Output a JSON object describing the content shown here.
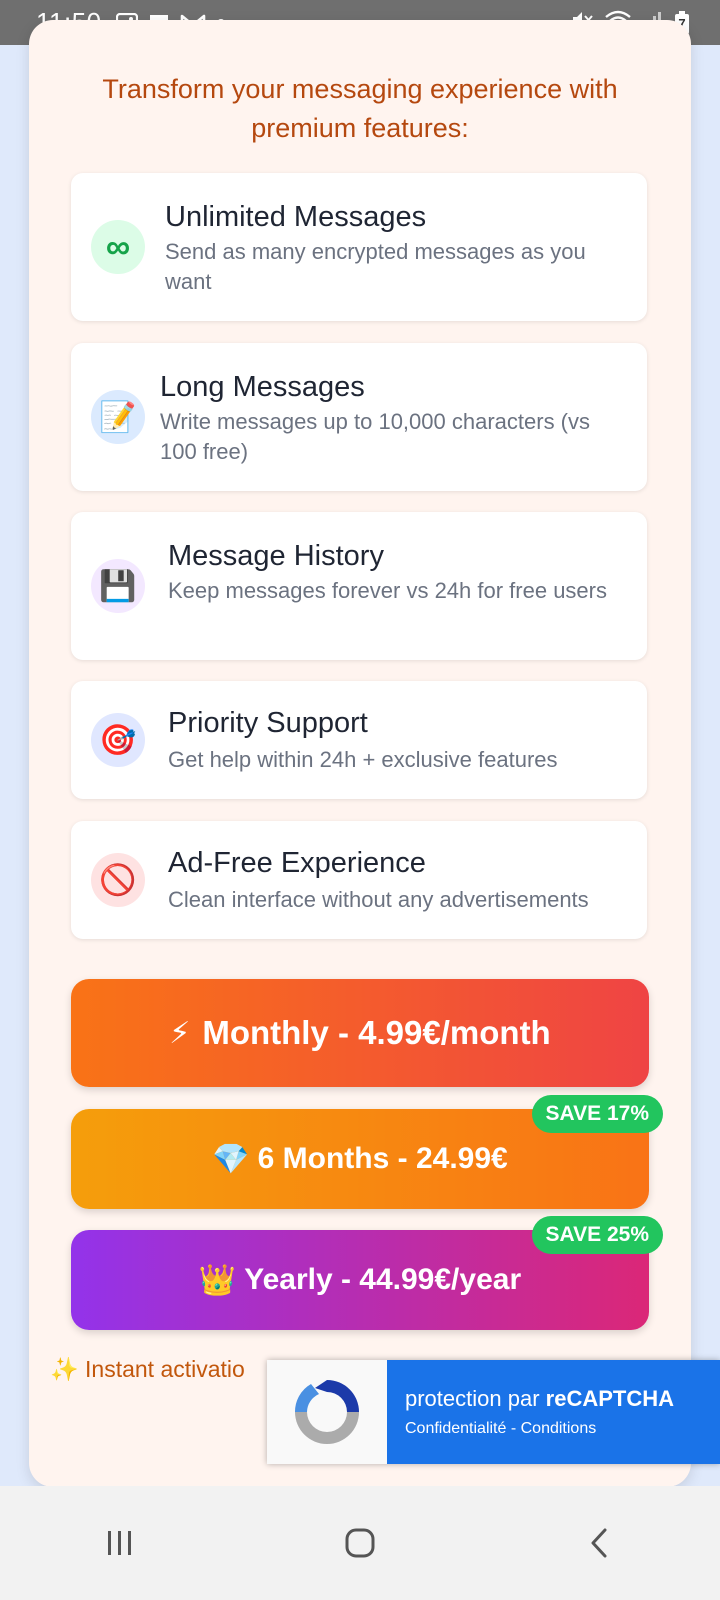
{
  "status_bar": {
    "time": "11:50",
    "left_icons": [
      "gallery-icon",
      "message-icon",
      "gmail-icon",
      "dot-icon"
    ],
    "right_icons": [
      "mute-icon",
      "wifi-icon",
      "signal-icon",
      "battery-icon"
    ],
    "battery_level": "7"
  },
  "intro_text": "Transform your messaging experience with premium features:",
  "features": [
    {
      "icon": "∞",
      "title": "Unlimited Messages",
      "desc": "Send as many encrypted messages as you want"
    },
    {
      "icon": "📝",
      "title": "Long Messages",
      "desc": "Write messages up to 10,000 characters (vs 100 free)"
    },
    {
      "icon": "💾",
      "title": "Message History",
      "desc": "Keep messages forever vs 24h for free users"
    },
    {
      "icon": "🎯",
      "title": "Priority Support",
      "desc": "Get help within 24h + exclusive features"
    },
    {
      "icon": "🚫",
      "title": "Ad-Free Experience",
      "desc": "Clean interface without any advertisements"
    }
  ],
  "plans": [
    {
      "icon": "⚡",
      "label": "Monthly - 4.99€/month",
      "badge": ""
    },
    {
      "icon": "💎",
      "label": "6 Months - 24.99€",
      "badge": "SAVE 17%"
    },
    {
      "icon": "👑",
      "label": "Yearly - 44.99€/year",
      "badge": "SAVE 25%"
    }
  ],
  "instant_text": "✨ Instant activatio",
  "recaptcha": {
    "main_prefix": "protection par ",
    "main_brand": "reCAPTCHA",
    "privacy": "Confidentialité",
    "separator": " - ",
    "terms": "Conditions"
  },
  "colors": {
    "accent_orange": "#f97316",
    "accent_red": "#ef4444",
    "accent_purple": "#9333ea",
    "accent_pink": "#db2777",
    "badge_green": "#22c55e",
    "recaptcha_blue": "#1a73e8"
  }
}
